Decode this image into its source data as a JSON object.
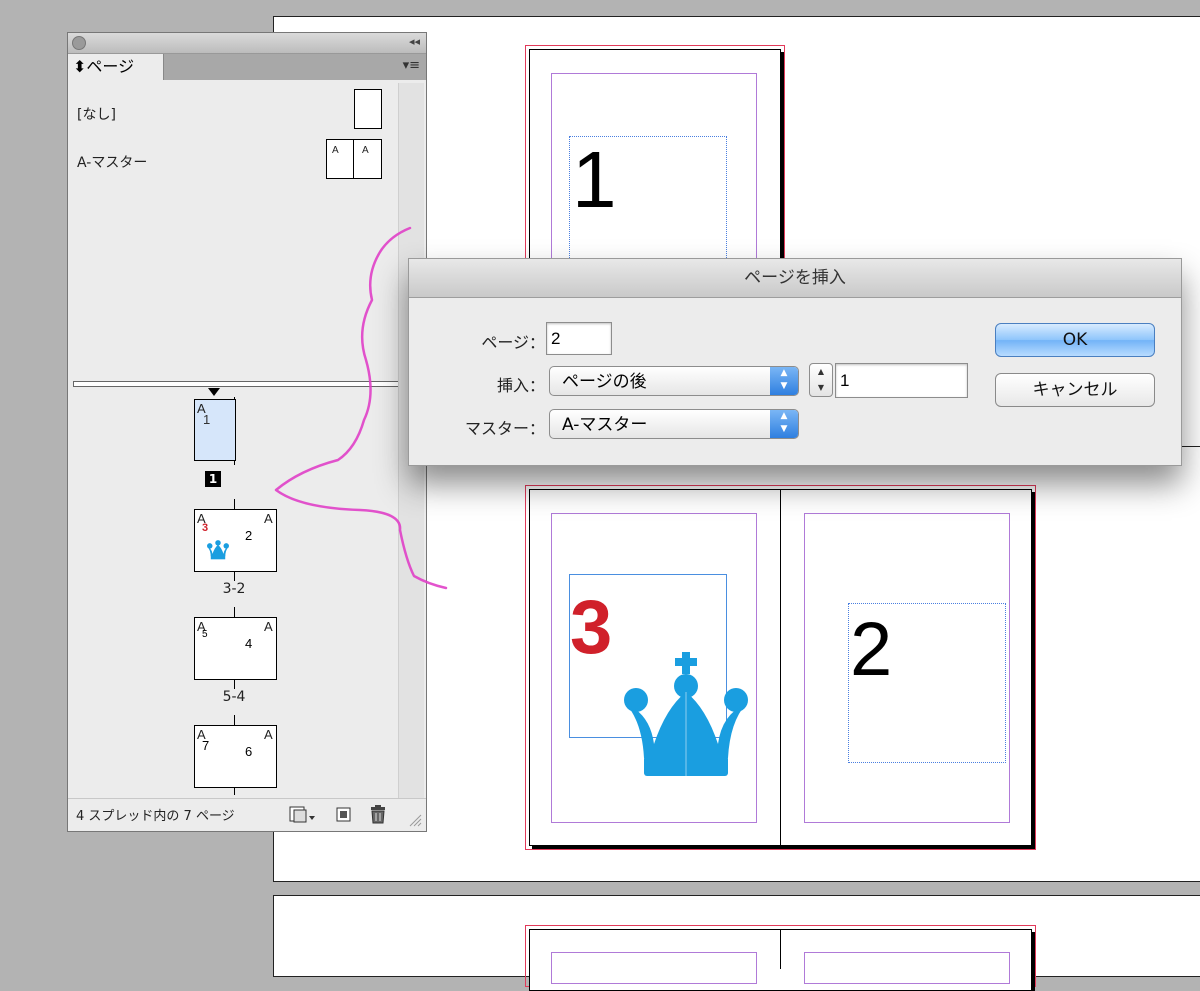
{
  "panel": {
    "collapse_glyph": "◂◂",
    "tab_label": "⬍ページ",
    "menu_glyph": "▾≡",
    "masters": [
      {
        "label": "[なし]"
      },
      {
        "label": "A-マスター",
        "left_mark": "A",
        "right_mark": "A"
      }
    ],
    "pages": {
      "p1": {
        "master": "A",
        "num": "1",
        "label": "1"
      },
      "spread2": {
        "master_l": "A",
        "master_r": "A",
        "num_l": "3",
        "num_r": "2",
        "label": "3-2"
      },
      "spread3": {
        "master_l": "A",
        "master_r": "A",
        "num_l": "5",
        "num_r": "4",
        "label": "5-4"
      },
      "spread4": {
        "master_l": "A",
        "master_r": "A",
        "num_l": "7",
        "num_r": "6"
      }
    },
    "footer": {
      "status": "4 スプレッド内の 7 ページ"
    }
  },
  "canvas": {
    "page1_number": "1",
    "spread_left_number": "3",
    "spread_right_number": "2"
  },
  "dialog": {
    "title": "ページを挿入",
    "page_label": "ページ：",
    "page_value": "2",
    "insert_label": "挿入：",
    "insert_option": "ページの後",
    "insert_count": "1",
    "master_label": "マスター：",
    "master_option": "A-マスター",
    "ok_label": "OK",
    "cancel_label": "キャンセル"
  },
  "colors": {
    "selected_thumb": "#d6e6fa",
    "crown_blue": "#1a9ee0",
    "red_number": "#d0202a",
    "annotation_pink": "#e040c8",
    "ok_button": "#72b3f7"
  },
  "icons": [
    "crown-icon",
    "new-page-icon",
    "trash-icon",
    "panel-menu-icon"
  ]
}
